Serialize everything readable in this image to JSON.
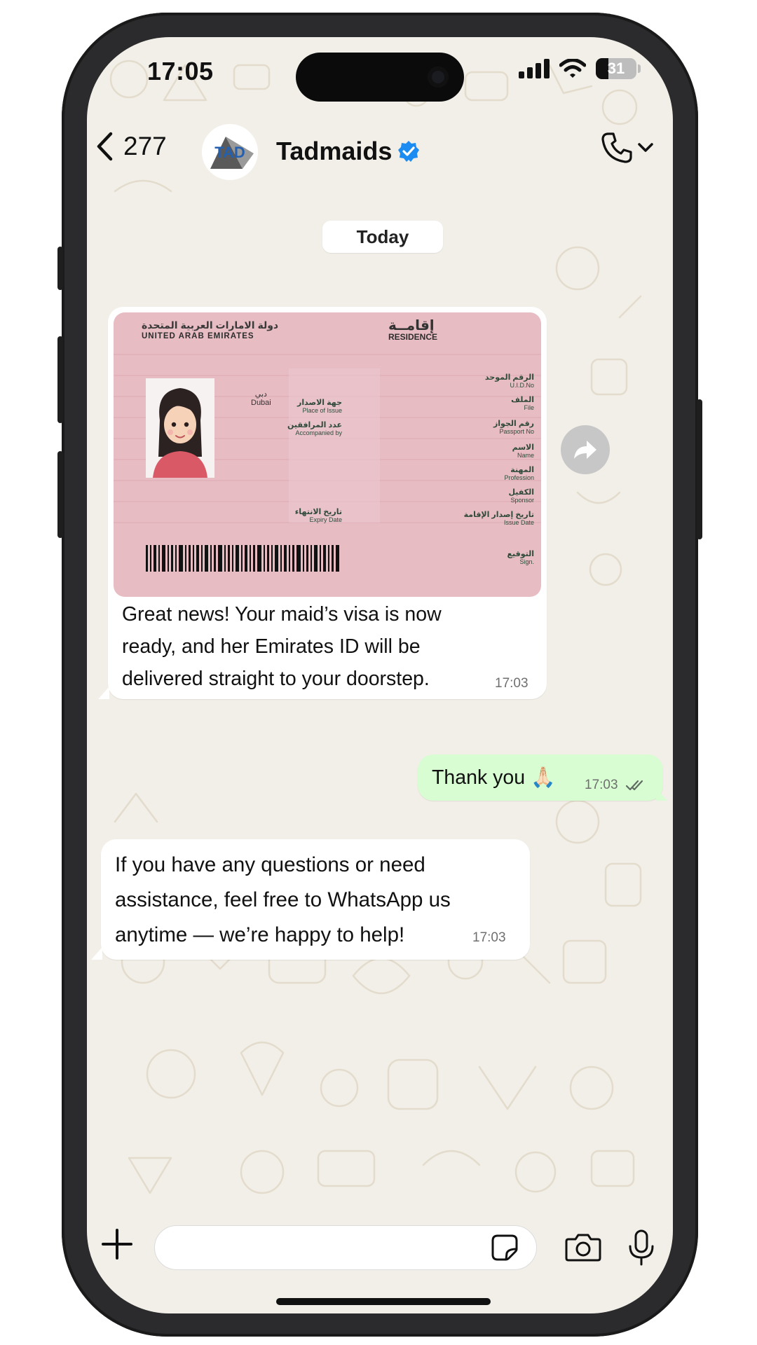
{
  "status_bar": {
    "time": "17:05",
    "battery": "31"
  },
  "header": {
    "back_count": "277",
    "contact_name": "Tadmaids",
    "avatar_text": "TAD"
  },
  "chat": {
    "date_label": "Today",
    "messages": [
      {
        "direction": "incoming",
        "has_image": true,
        "text": "Great news! Your maid’s visa is now ready, and her Emirates ID will be delivered straight to your doorstep.",
        "time": "17:03"
      },
      {
        "direction": "outgoing",
        "text": "Thank you 🙏🏻",
        "time": "17:03",
        "status": "read"
      },
      {
        "direction": "incoming",
        "text": "If you have any questions or need assistance, feel free to WhatsApp us anytime — we’re happy to help!",
        "time": "17:03"
      }
    ],
    "visa_card": {
      "header_ar": "دولة الامارات العربية المتحدة",
      "header_en": "UNITED ARAB EMIRATES",
      "title_ar": "إقامــة",
      "title_en": "RESIDENCE",
      "city_ar": "دبي",
      "city_en": "Dubai",
      "left_fields": [
        {
          "ar": "جهة الاصدار",
          "en": "Place of Issue"
        },
        {
          "ar": "عدد المرافقين",
          "en": "Accompanied by"
        },
        {
          "ar": "تاريخ الانتهاء",
          "en": "Expiry Date"
        }
      ],
      "right_fields": [
        {
          "ar": "الرقم الموحد",
          "en": "U.I.D.No"
        },
        {
          "ar": "الملف",
          "en": "File"
        },
        {
          "ar": "رقم الجواز",
          "en": "Passport No"
        },
        {
          "ar": "الاسم",
          "en": "Name"
        },
        {
          "ar": "المهنة",
          "en": "Profession"
        },
        {
          "ar": "الكفيل",
          "en": "Sponsor"
        },
        {
          "ar": "تاريخ إصدار الإقامة",
          "en": "Issue Date"
        },
        {
          "ar": "التوقيع",
          "en": "Sign."
        }
      ]
    }
  },
  "icons": {
    "back": "chevron-left-icon",
    "verified": "verified-badge-icon",
    "call": "phone-icon",
    "forward": "forward-icon",
    "plus": "plus-icon",
    "sticker": "sticker-icon",
    "camera": "camera-icon",
    "mic": "microphone-icon",
    "read": "double-check-icon"
  },
  "colors": {
    "wallpaper": "#f2efe8",
    "incoming_bubble": "#ffffff",
    "outgoing_bubble": "#d8fdd2",
    "verified": "#1d8cf2",
    "read_ticks": "#5f6b63",
    "card": "#e8bcc3"
  }
}
